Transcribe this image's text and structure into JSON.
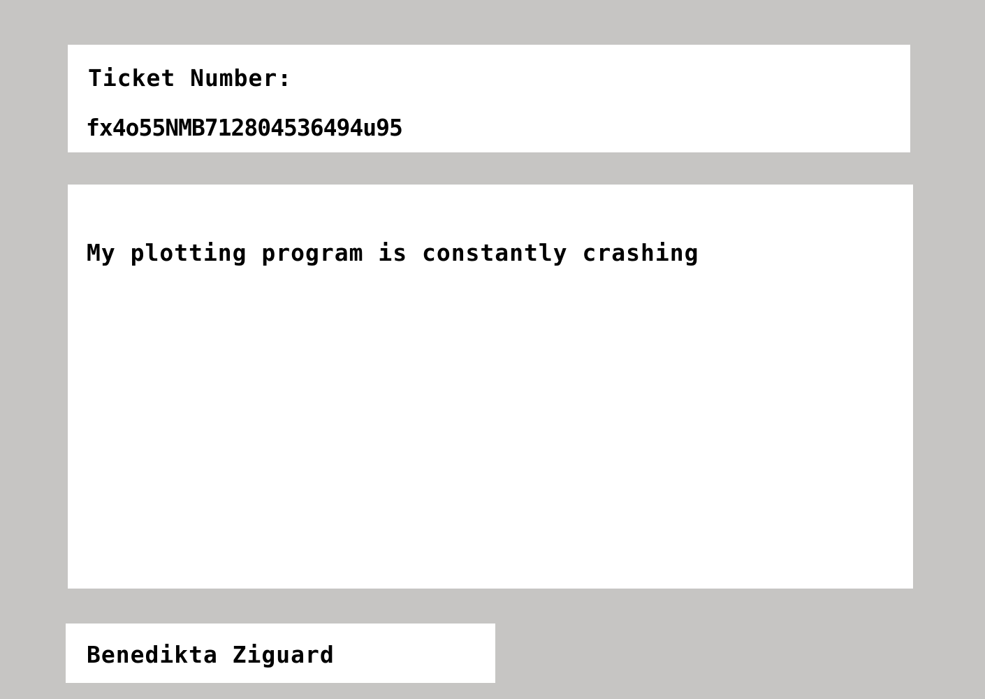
{
  "ticket": {
    "label": "Ticket Number:",
    "number": "fx4o55NMB712804536494u95"
  },
  "description": {
    "text": "My plotting program is constantly crashing"
  },
  "requester": {
    "name": "Benedikta Ziguard"
  },
  "colors": {
    "background": "#c6c5c3",
    "panel": "#ffffff",
    "text": "#000000"
  }
}
